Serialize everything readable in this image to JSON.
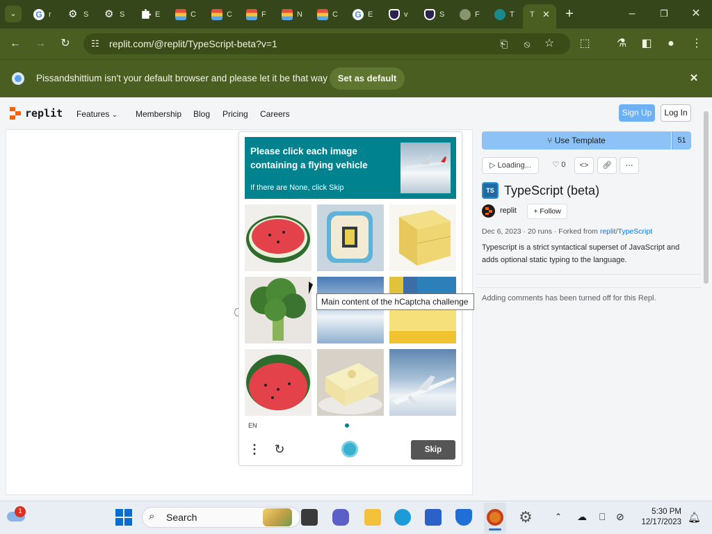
{
  "browser": {
    "tabs": [
      {
        "icon": "google-icon",
        "title": "r"
      },
      {
        "icon": "gear-icon",
        "title": "S"
      },
      {
        "icon": "gear-icon",
        "title": "S"
      },
      {
        "icon": "puzzle-icon",
        "title": "E"
      },
      {
        "icon": "rainbow-icon",
        "title": "C"
      },
      {
        "icon": "rainbow-icon",
        "title": "C"
      },
      {
        "icon": "rainbow-icon",
        "title": "F"
      },
      {
        "icon": "rainbow-icon",
        "title": "N"
      },
      {
        "icon": "rainbow-icon",
        "title": "C"
      },
      {
        "icon": "google-icon",
        "title": "E"
      },
      {
        "icon": "shield-icon",
        "title": "v"
      },
      {
        "icon": "shield-icon",
        "title": "S"
      },
      {
        "icon": "globe-icon",
        "title": "F"
      },
      {
        "icon": "globe-teal-icon",
        "title": "T"
      },
      {
        "icon": "none",
        "title": "T"
      }
    ],
    "url": "replit.com/@replit/TypeScript-beta?v=1",
    "infobar_text": "Pissandshittium isn't your default browser and please let it be that way",
    "infobar_button": "Set as default",
    "accent": "#4b5e22"
  },
  "site": {
    "brand": "replit",
    "nav": [
      "Features",
      "Membership",
      "Blog",
      "Pricing",
      "Careers"
    ],
    "signup": "Sign Up",
    "login": "Log In"
  },
  "repl": {
    "use_template": "Use Template",
    "template_count": "51",
    "run_status": "Loading...",
    "likes": "0",
    "badge": "TS",
    "title": "TypeScript (beta)",
    "owner": "replit",
    "follow": "Follow",
    "meta_prefix": "Dec 6, 2023 · 20 runs · Forked from",
    "forked_owner": "replit",
    "forked_sep": "/",
    "forked_repl": "TypeScript",
    "description": "Typescript is a strict syntactical superset of JavaScript and adds optional static typing to the language.",
    "comments": "Adding comments has been turned off for this Repl."
  },
  "captcha": {
    "prompt": "Please click each image containing a flying vehicle",
    "sub": "If there are None, click Skip",
    "images": [
      "watermelon",
      "cake-slice",
      "cheese-cubes",
      "broccoli",
      "sky-clouds",
      "cheesecake-layers",
      "watermelon",
      "cheesecake",
      "airplane"
    ],
    "tooltip": "Main content of the hCaptcha challenge",
    "language": "EN",
    "skip": "Skip"
  },
  "taskbar": {
    "search": "Search",
    "notification_count": "1",
    "time": "5:30 PM",
    "date": "12/17/2023"
  }
}
